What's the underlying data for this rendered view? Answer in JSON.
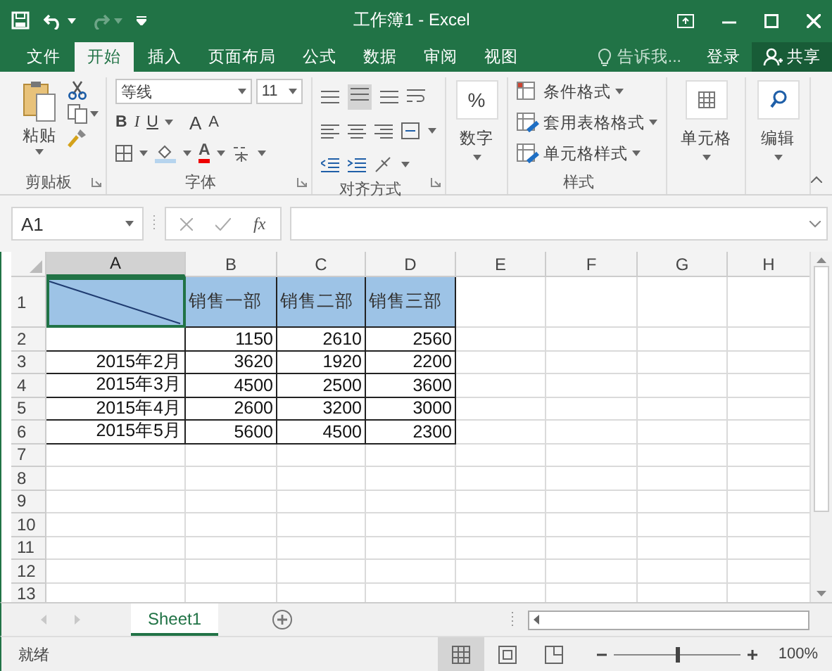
{
  "window": {
    "title": "工作簿1 - Excel"
  },
  "menu_tabs": [
    {
      "label": "文件",
      "selected": false
    },
    {
      "label": "开始",
      "selected": true
    },
    {
      "label": "插入",
      "selected": false
    },
    {
      "label": "页面布局",
      "selected": false
    },
    {
      "label": "公式",
      "selected": false
    },
    {
      "label": "数据",
      "selected": false
    },
    {
      "label": "审阅",
      "selected": false
    },
    {
      "label": "视图",
      "selected": false
    }
  ],
  "tell_me": {
    "placeholder": "告诉我..."
  },
  "sign_in": "登录",
  "share": "共享",
  "ribbon": {
    "clipboard": {
      "paste": "粘贴",
      "label": "剪贴板"
    },
    "font": {
      "name": "等线",
      "size": "11",
      "bold": "B",
      "italic": "I",
      "underline": "U",
      "grow": "A",
      "shrink": "A",
      "font_color": "A",
      "label": "字体"
    },
    "alignment": {
      "label": "对齐方式"
    },
    "number": {
      "symbol": "%",
      "button": "数字"
    },
    "styles": {
      "items": [
        "条件格式",
        "套用表格格式",
        "单元格样式"
      ],
      "label": "样式"
    },
    "cells": {
      "button": "单元格"
    },
    "editing": {
      "button": "编辑"
    }
  },
  "formula_bar": {
    "name_box": "A1",
    "fx": "fx"
  },
  "sheet": {
    "columns": [
      {
        "label": "A",
        "selected": true
      },
      {
        "label": "B",
        "selected": false
      },
      {
        "label": "C",
        "selected": false
      },
      {
        "label": "D",
        "selected": false
      },
      {
        "label": "E",
        "selected": false
      },
      {
        "label": "F",
        "selected": false
      },
      {
        "label": "G",
        "selected": false
      },
      {
        "label": "H",
        "selected": false
      }
    ],
    "rows": [
      {
        "label": "1",
        "kind": "header",
        "cells": [
          "销售一部",
          "销售二部",
          "销售三部"
        ]
      },
      {
        "label": "2",
        "kind": "data",
        "cells": [
          "1150",
          "2610",
          "2560"
        ]
      },
      {
        "label": "3",
        "kind": "data",
        "month": "2015年2月",
        "cells": [
          "3620",
          "1920",
          "2200"
        ]
      },
      {
        "label": "4",
        "kind": "data",
        "month": "2015年3月",
        "cells": [
          "4500",
          "2500",
          "3600"
        ]
      },
      {
        "label": "5",
        "kind": "data",
        "month": "2015年4月",
        "cells": [
          "2600",
          "3200",
          "3000"
        ]
      },
      {
        "label": "6",
        "kind": "data",
        "month": "2015年5月",
        "cells": [
          "5600",
          "4500",
          "2300"
        ]
      },
      {
        "label": "7",
        "kind": "empty"
      },
      {
        "label": "8",
        "kind": "empty"
      },
      {
        "label": "9",
        "kind": "empty"
      },
      {
        "label": "10",
        "kind": "empty"
      },
      {
        "label": "11",
        "kind": "empty"
      },
      {
        "label": "12",
        "kind": "empty"
      },
      {
        "label": "13",
        "kind": "empty"
      }
    ]
  },
  "sheet_tabs": [
    {
      "label": "Sheet1",
      "selected": true
    }
  ],
  "status_bar": {
    "text": "就绪",
    "views": [
      {
        "kind": "normal",
        "selected": true
      },
      {
        "kind": "page_layout",
        "selected": false
      },
      {
        "kind": "page_break",
        "selected": false
      }
    ],
    "zoom": {
      "level": 0.5
    },
    "zoom_text": "100%"
  }
}
